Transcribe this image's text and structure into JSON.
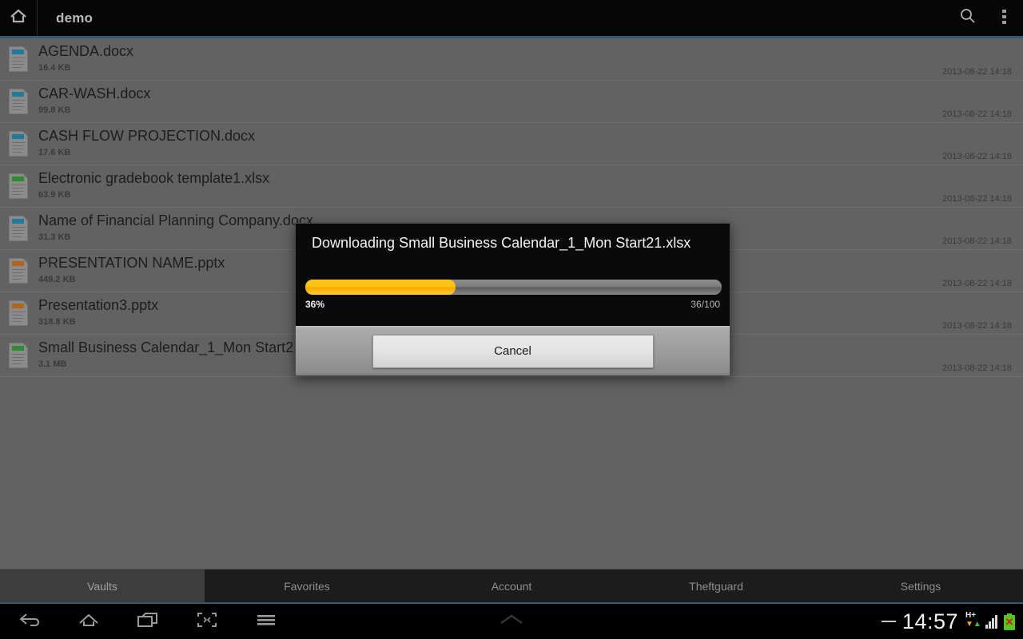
{
  "action_bar": {
    "home_icon": "home-icon",
    "title": "demo",
    "search_icon": "search-icon",
    "overflow_icon": "overflow-menu-icon"
  },
  "file_list": {
    "rows": [
      {
        "name": "AGENDA.docx",
        "size": "16.4 KB",
        "date": "2013-08-22 14:18",
        "type": "docx",
        "icon_color": "#1f7a9b"
      },
      {
        "name": "CAR-WASH.docx",
        "size": "99.8 KB",
        "date": "2013-08-22 14:18",
        "type": "docx",
        "icon_color": "#1f7a9b"
      },
      {
        "name": "CASH FLOW PROJECTION.docx",
        "size": "17.6 KB",
        "date": "2013-08-22 14:18",
        "type": "docx",
        "icon_color": "#1f7a9b"
      },
      {
        "name": "Electronic gradebook template1.xlsx",
        "size": "63.9 KB",
        "date": "2013-08-22 14:18",
        "type": "xlsx",
        "icon_color": "#2f8b2f"
      },
      {
        "name": "Name of Financial Planning Company.docx",
        "size": "31.3 KB",
        "date": "2013-08-22 14:18",
        "type": "docx",
        "icon_color": "#1f7a9b"
      },
      {
        "name": "PRESENTATION  NAME.pptx",
        "size": "449.2 KB",
        "date": "2013-08-22 14:18",
        "type": "pptx",
        "icon_color": "#b3641a"
      },
      {
        "name": "Presentation3.pptx",
        "size": "318.8 KB",
        "date": "2013-08-22 14:18",
        "type": "pptx",
        "icon_color": "#b3641a"
      },
      {
        "name": "Small Business Calendar_1_Mon Start21.xlsx",
        "size": "3.1 MB",
        "date": "2013-08-22 14:18",
        "type": "xlsx",
        "icon_color": "#2f8b2f"
      }
    ]
  },
  "dialog": {
    "title": "Downloading Small Business Calendar_1_Mon Start21.xlsx",
    "progress_percent_label": "36%",
    "progress_count_label": "36/100",
    "progress_value": 36,
    "progress_max": 100,
    "progress_color": "#ffc20d",
    "cancel_label": "Cancel"
  },
  "tab_bar": {
    "tabs": [
      {
        "label": "Vaults",
        "selected": true
      },
      {
        "label": "Favorites",
        "selected": false
      },
      {
        "label": "Account",
        "selected": false
      },
      {
        "label": "Theftguard",
        "selected": false
      },
      {
        "label": "Settings",
        "selected": false
      }
    ],
    "accent_color": "#2e5d73"
  },
  "nav_bar": {
    "buttons": [
      "back-icon",
      "home-icon",
      "recents-icon",
      "screenshot-icon",
      "menu-icon"
    ],
    "center_icon": "chevron-up-icon",
    "status": {
      "dash": "—",
      "clock": "14:57",
      "network_type": "H+",
      "data_arrows": "↓↑",
      "signal_bars": 4,
      "battery_state": "battery-error"
    }
  }
}
